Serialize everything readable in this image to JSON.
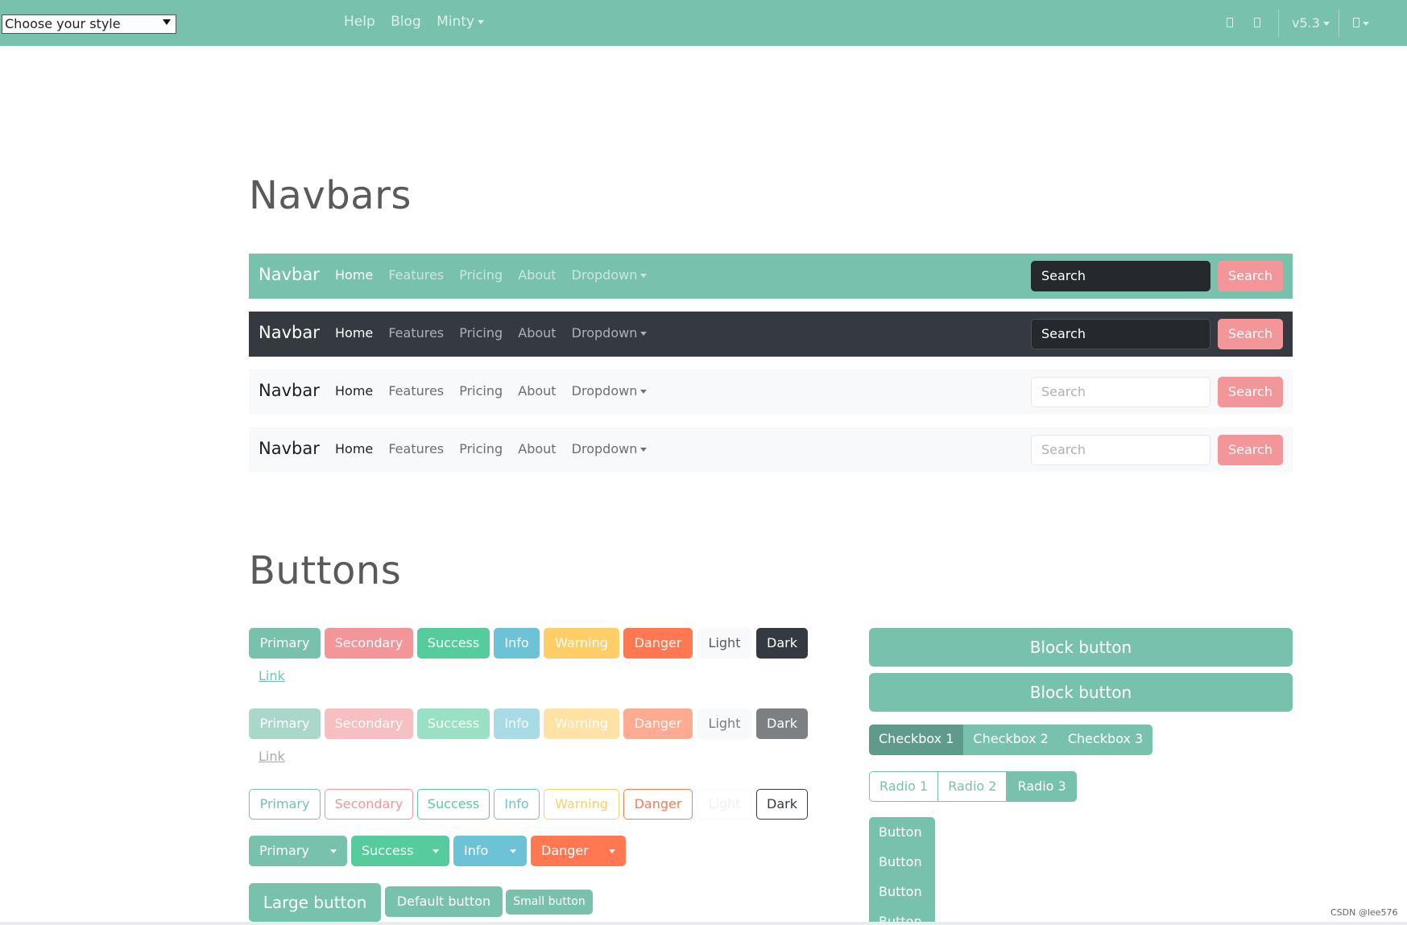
{
  "topbar": {
    "style_select": "Choose your style",
    "links": [
      "Help",
      "Blog",
      "Minty"
    ],
    "version": "v5.3"
  },
  "sections": {
    "navbars_title": "Navbars",
    "buttons_title": "Buttons"
  },
  "navbar": {
    "brand": "Navbar",
    "links": [
      "Home",
      "Features",
      "Pricing",
      "About",
      "Dropdown"
    ],
    "search_placeholder": "Search",
    "search_button": "Search"
  },
  "buttons": {
    "row_labels": [
      "Primary",
      "Secondary",
      "Success",
      "Info",
      "Warning",
      "Danger",
      "Light",
      "Dark"
    ],
    "link_label": "Link",
    "split": [
      "Primary",
      "Success",
      "Info",
      "Danger"
    ],
    "sizes": [
      "Large button",
      "Default button",
      "Small button"
    ],
    "block": "Block button",
    "checkboxes": [
      "Checkbox 1",
      "Checkbox 2",
      "Checkbox 3"
    ],
    "radios": [
      "Radio 1",
      "Radio 2",
      "Radio 3"
    ],
    "vertical": [
      "Button",
      "Button",
      "Button",
      "Button"
    ]
  },
  "colors": {
    "primary": "#78c2ad",
    "secondary": "#f3969a",
    "success": "#56cc9d",
    "info": "#6cc3d5",
    "warning": "#ffce67",
    "danger": "#ff7851",
    "light": "#f8f9fa",
    "dark": "#343a40"
  },
  "watermark": "CSDN @lee576"
}
